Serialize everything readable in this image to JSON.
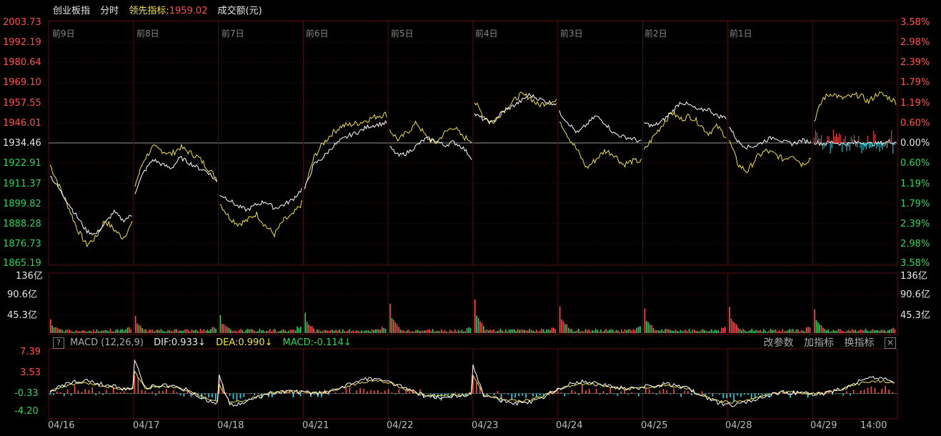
{
  "header": {
    "index_name": "创业板指",
    "mode": "分时",
    "leading_label": "领先指标:",
    "leading_value": "1959.02",
    "volume_label": "成交额(元)"
  },
  "price_axis": {
    "left": [
      "2003.73",
      "1992.19",
      "1980.64",
      "1969.10",
      "1957.55",
      "1946.01",
      "1934.46",
      "1922.91",
      "1911.37",
      "1899.82",
      "1888.28",
      "1876.73",
      "1865.19"
    ],
    "right": [
      "3.58%",
      "2.98%",
      "2.39%",
      "1.79%",
      "1.19%",
      "0.60%",
      "0.00%",
      "0.60%",
      "1.19%",
      "1.79%",
      "2.39%",
      "2.98%",
      "3.58%"
    ]
  },
  "day_labels": [
    "前9日",
    "前8日",
    "前7日",
    "前6日",
    "前5日",
    "前4日",
    "前3日",
    "前2日",
    "前1日"
  ],
  "volume_axis": {
    "left": [
      "136亿",
      "90.6亿",
      "45.3亿"
    ],
    "right": [
      "136亿",
      "90.6亿",
      "45.3亿"
    ]
  },
  "macd": {
    "help": "?",
    "title": "MACD (12,26,9)",
    "dif": "DIF:0.933↓",
    "dea": "DEA:0.990↓",
    "macd": "MACD:-0.114↓",
    "buttons": [
      "改参数",
      "加指标",
      "换指标"
    ],
    "close": "×",
    "axis": [
      "7.39",
      "3.53",
      "-0.33",
      "-4.20"
    ]
  },
  "date_labels": [
    "04/16",
    "04/17",
    "04/18",
    "04/21",
    "04/22",
    "04/23",
    "04/24",
    "04/25",
    "04/28",
    "04/29",
    "14:00"
  ],
  "colors": {
    "up": "#ff4d4d",
    "down": "#2fd35c",
    "price": "#ffffff",
    "leading": "#f0e14a",
    "macd_neg": "#1fe0f0",
    "grid": "#3a0a0a"
  },
  "chart_data": {
    "type": "line",
    "title": "创业板指 分时",
    "y_range": [
      1865.19,
      2003.73
    ],
    "reference": 1934.46,
    "days": [
      "04/16",
      "04/17",
      "04/18",
      "04/21",
      "04/22",
      "04/23",
      "04/24",
      "04/25",
      "04/28",
      "04/29"
    ],
    "series": [
      {
        "name": "创业板指",
        "day_values": [
          [
            1916,
            1908,
            1900,
            1892,
            1884,
            1882,
            1888,
            1895,
            1890,
            1893
          ],
          [
            1906,
            1918,
            1925,
            1922,
            1920,
            1926,
            1923,
            1920,
            1918,
            1912
          ],
          [
            1905,
            1902,
            1898,
            1896,
            1899,
            1901,
            1897,
            1899,
            1902,
            1908
          ],
          [
            1908,
            1922,
            1926,
            1932,
            1936,
            1939,
            1941,
            1944,
            1945,
            1946
          ],
          [
            1932,
            1927,
            1929,
            1933,
            1937,
            1936,
            1933,
            1935,
            1932,
            1926
          ],
          [
            1951,
            1948,
            1946,
            1952,
            1955,
            1958,
            1962,
            1960,
            1958,
            1957
          ],
          [
            1952,
            1946,
            1940,
            1945,
            1950,
            1946,
            1940,
            1938,
            1937,
            1935
          ],
          [
            1946,
            1944,
            1947,
            1952,
            1958,
            1956,
            1953,
            1954,
            1950,
            1949
          ],
          [
            1944,
            1935,
            1932,
            1933,
            1936,
            1938,
            1935,
            1934,
            1936,
            1935
          ],
          [
            1935,
            1934,
            1935,
            1934,
            1934,
            1935,
            1934,
            1934,
            1935,
            1935
          ]
        ]
      },
      {
        "name": "领先指标",
        "day_values": [
          [
            1922,
            1910,
            1898,
            1885,
            1876,
            1880,
            1890,
            1885,
            1880,
            1888
          ],
          [
            1910,
            1925,
            1932,
            1930,
            1928,
            1932,
            1929,
            1926,
            1920,
            1914
          ],
          [
            1900,
            1892,
            1888,
            1890,
            1894,
            1887,
            1882,
            1890,
            1893,
            1900
          ],
          [
            1908,
            1926,
            1934,
            1940,
            1944,
            1945,
            1946,
            1948,
            1950,
            1951
          ],
          [
            1942,
            1936,
            1941,
            1946,
            1938,
            1934,
            1940,
            1944,
            1938,
            1936
          ],
          [
            1958,
            1950,
            1946,
            1952,
            1957,
            1962,
            1961,
            1956,
            1958,
            1958
          ],
          [
            1948,
            1938,
            1930,
            1920,
            1925,
            1930,
            1928,
            1922,
            1924,
            1924
          ],
          [
            1930,
            1938,
            1945,
            1952,
            1948,
            1950,
            1946,
            1940,
            1944,
            1938
          ],
          [
            1936,
            1922,
            1918,
            1926,
            1930,
            1928,
            1925,
            1928,
            1922,
            1926
          ],
          [
            1947,
            1960,
            1963,
            1960,
            1961,
            1962,
            1958,
            1963,
            1961,
            1958
          ]
        ]
      }
    ],
    "volume": {
      "unit": "亿",
      "y_range": [
        0,
        136
      ],
      "peaks": [
        32,
        40,
        42,
        47,
        68,
        78,
        62,
        57,
        61,
        55
      ]
    },
    "macd": {
      "y_range": [
        -4.2,
        7.39
      ]
    }
  }
}
